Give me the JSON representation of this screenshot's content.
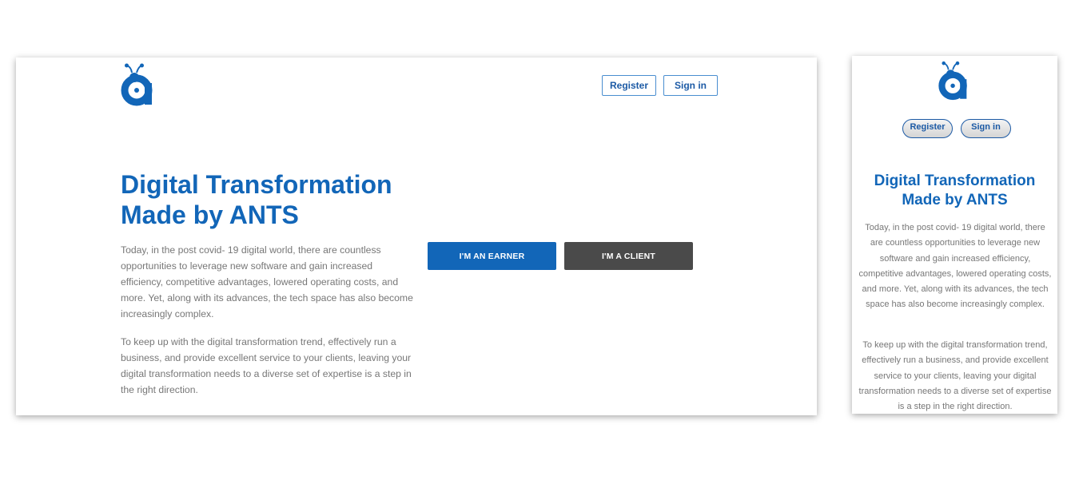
{
  "brand": {
    "name": "ANTS",
    "primary_color": "#1266b8",
    "dark_color": "#4a4a4a",
    "logo_icon": "ant-a-logo-icon"
  },
  "desktop": {
    "nav": {
      "register_label": "Register",
      "signin_label": "Sign in"
    },
    "hero": {
      "title_line1": "Digital Transformation",
      "title_line2": "Made by ANTS",
      "paragraph1": "Today, in the post covid- 19 digital world, there are countless opportunities to leverage new software and gain increased efficiency, competitive advantages, lowered operating costs, and more. Yet, along with its advances, the tech space has also become increasingly complex.",
      "paragraph2": "To keep up with the digital transformation trend, effectively run a business, and provide excellent service to your clients, leaving your digital transformation needs to a diverse set of expertise is a step in the right direction.",
      "earner_label": "I'M AN EARNER",
      "client_label": "I'M A CLIENT"
    }
  },
  "mobile": {
    "nav": {
      "register_label": "Register",
      "signin_label": "Sign in"
    },
    "hero": {
      "title_line1": "Digital Transformation",
      "title_line2": "Made by ANTS",
      "paragraph1": "Today, in the post covid- 19 digital world, there are countless opportunities to leverage new software and gain increased efficiency, competitive advantages, lowered operating costs, and more. Yet, along with its advances, the tech space has also become increasingly complex.",
      "paragraph2": "To keep up with the digital transformation trend, effectively run a business, and provide excellent service to your clients, leaving your digital transformation needs to a diverse set of expertise is a step in the right direction."
    }
  }
}
